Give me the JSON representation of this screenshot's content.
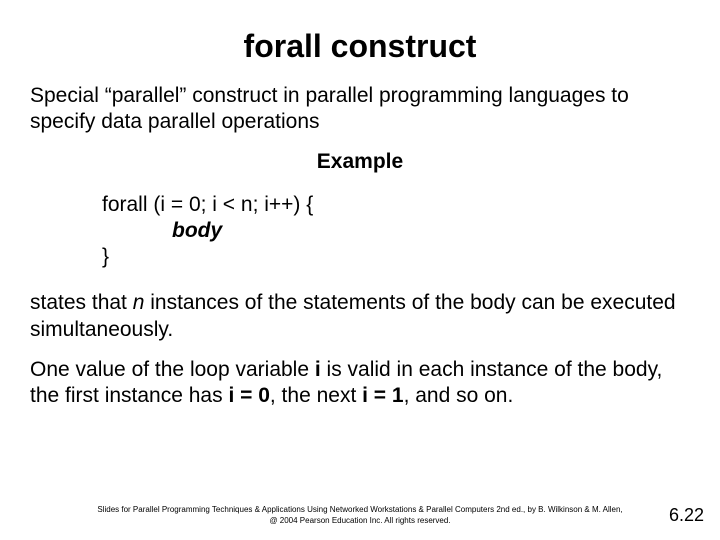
{
  "title_part1": "forall",
  "title_part2": " construct",
  "intro": "Special “parallel” construct in parallel programming languages to specify data parallel operations",
  "example_label": "Example",
  "code": {
    "line1": "forall (i = 0; i < n; i++) {",
    "body_indent": "            ",
    "body_kw": "body",
    "line3": "}"
  },
  "p2_a": "states that ",
  "p2_n": "n",
  "p2_b": " instances of the statements of the body can be executed simultaneously.",
  "p3_a": "One value of the loop variable ",
  "p3_i": "i",
  "p3_b": " is valid in each instance of the body, the first instance has ",
  "p3_i0": "i = 0",
  "p3_c": ", the next ",
  "p3_i1": "i = 1",
  "p3_d": ", and so on.",
  "footer_line1": "Slides for Parallel Programming Techniques & Applications Using Networked Workstations & Parallel Computers 2nd ed., by B. Wilkinson & M. Allen,",
  "footer_line2": "@ 2004 Pearson Education Inc. All rights reserved.",
  "page_number": "6.22"
}
